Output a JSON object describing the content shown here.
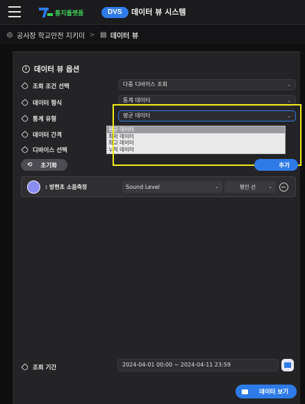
{
  "header": {
    "logo_text": "통지플랫폼",
    "badge": "DVS",
    "title": "데이터 뷰 시스템"
  },
  "breadcrumb": {
    "parent": "공사장 학교안전 지키미",
    "separator": ">",
    "current": "데이터 뷰"
  },
  "panel": {
    "title": "데이터 뷰 옵션",
    "rows": [
      {
        "label": "조회 조건 선택",
        "value": "다중 디바이스 조회"
      },
      {
        "label": "데이터 형식",
        "value": "통계 데이터"
      },
      {
        "label": "통계 유형",
        "value": "평균 데이터"
      },
      {
        "label": "데이터 간격",
        "value": ""
      },
      {
        "label": "디바이스 선택",
        "value": ""
      }
    ],
    "dropdown_options": [
      "평균 데이터",
      "최저 데이터",
      "최고 데이터",
      "누적 데이터"
    ],
    "dropdown_selected": "평균 데이터",
    "reset_label": "초기화",
    "add_label": "추가"
  },
  "device": {
    "name": "방현초 소음측정",
    "sensor": "Sound Level",
    "line_type": "평인 선"
  },
  "period": {
    "label": "조회 기간",
    "value": "2024-04-01 00:00 ~ 2024-04-11 23:59"
  },
  "view_button": "데이터 보기",
  "colors": {
    "accent": "#2e7be8",
    "brand_green": "#3fd15a",
    "highlight": "#f2ec17",
    "device_color": "#8a8cf0"
  }
}
